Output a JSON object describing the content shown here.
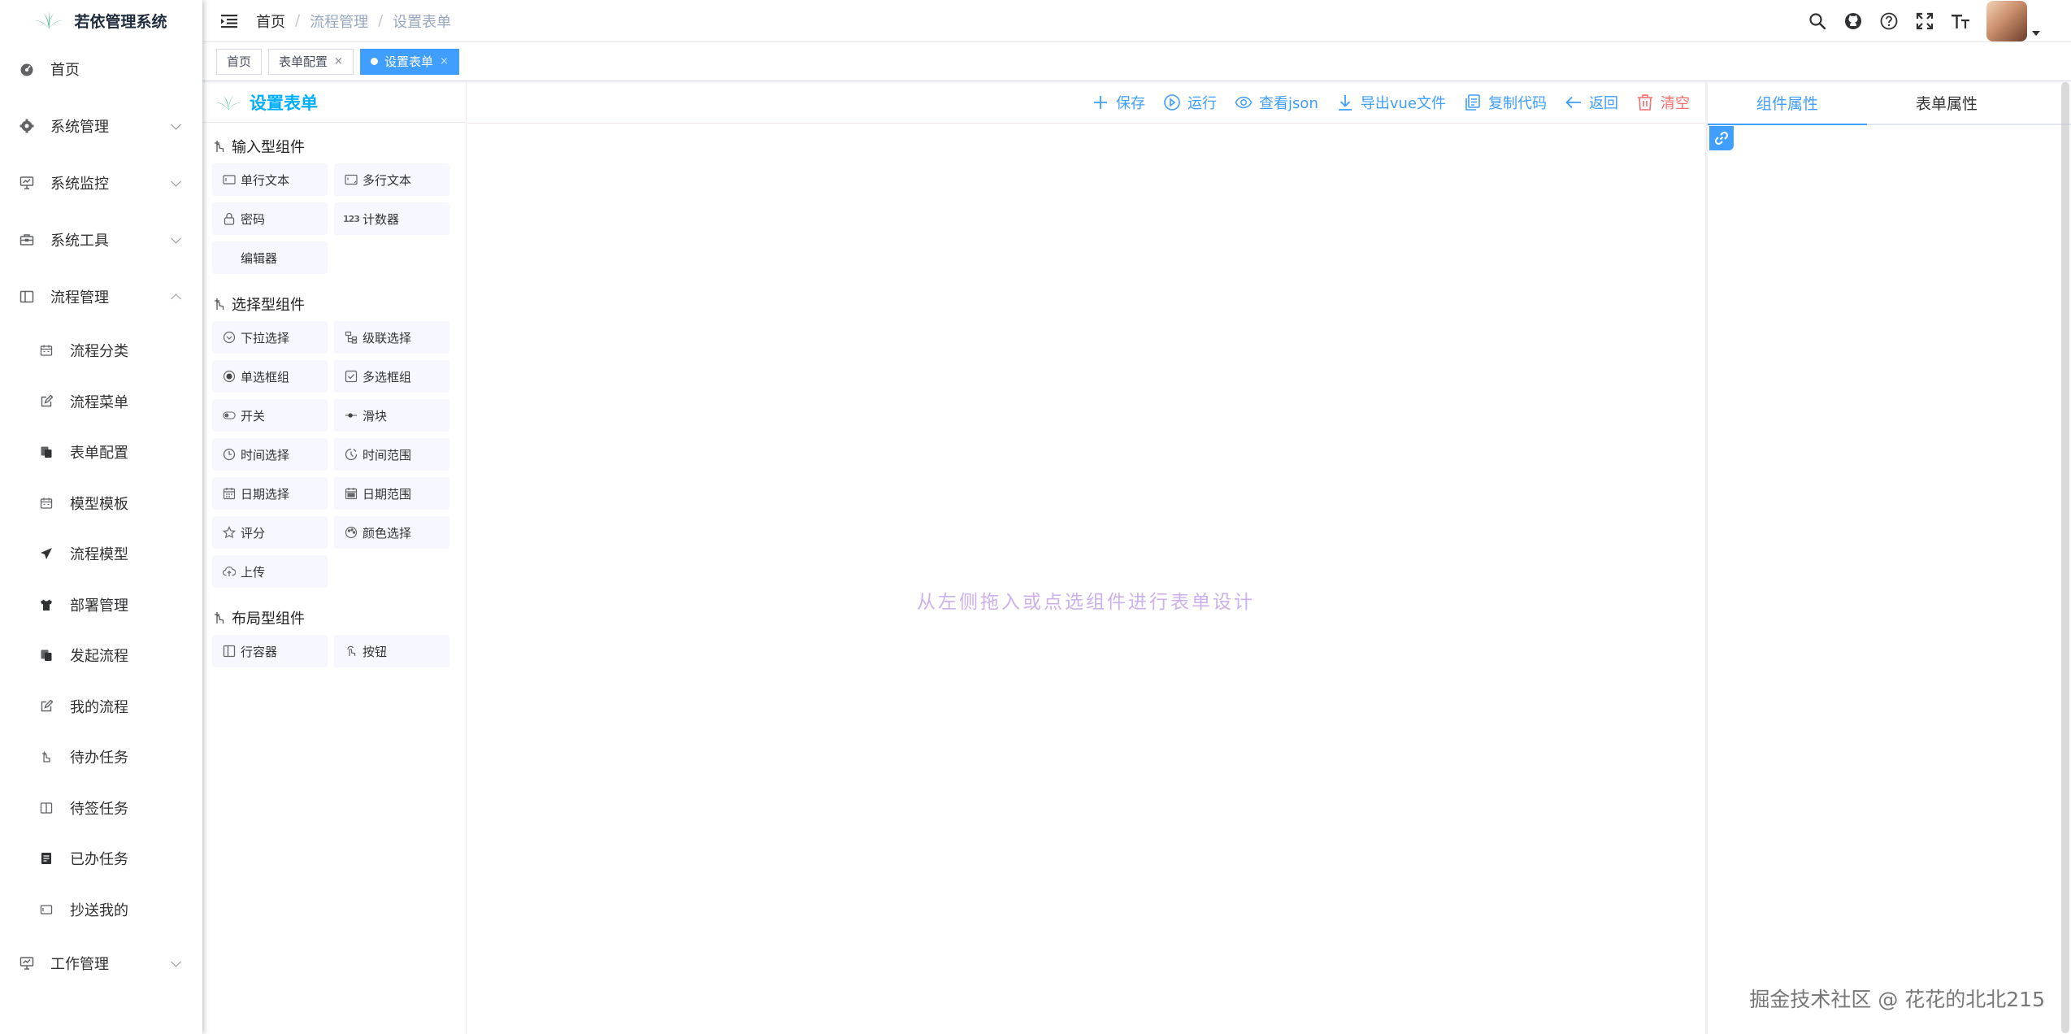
{
  "sidebar": {
    "title": "若依管理系统",
    "items": [
      {
        "label": "首页",
        "icon": "dashboard-icon",
        "expandable": false
      },
      {
        "label": "系统管理",
        "icon": "gear-icon",
        "expandable": true
      },
      {
        "label": "系统监控",
        "icon": "monitor-icon",
        "expandable": true
      },
      {
        "label": "系统工具",
        "icon": "toolbox-icon",
        "expandable": true
      },
      {
        "label": "流程管理",
        "icon": "flow-icon",
        "expandable": true,
        "expanded": true,
        "children": [
          {
            "label": "流程分类",
            "icon": "calendar-icon"
          },
          {
            "label": "流程菜单",
            "icon": "edit-icon"
          },
          {
            "label": "表单配置",
            "icon": "copy-icon"
          },
          {
            "label": "模型模板",
            "icon": "calendar-icon"
          },
          {
            "label": "流程模型",
            "icon": "send-icon"
          },
          {
            "label": "部署管理",
            "icon": "shirt-icon"
          },
          {
            "label": "发起流程",
            "icon": "copy-icon"
          },
          {
            "label": "我的流程",
            "icon": "edit-icon"
          },
          {
            "label": "待办任务",
            "icon": "drag-icon"
          },
          {
            "label": "待签任务",
            "icon": "book-icon"
          },
          {
            "label": "已办任务",
            "icon": "document-icon"
          },
          {
            "label": "抄送我的",
            "icon": "card-icon"
          }
        ]
      },
      {
        "label": "工作管理",
        "icon": "monitor-icon",
        "expandable": true
      }
    ]
  },
  "navbar": {
    "breadcrumb": [
      "首页",
      "流程管理",
      "设置表单"
    ]
  },
  "tags": [
    {
      "label": "首页",
      "active": false,
      "closable": false
    },
    {
      "label": "表单配置",
      "active": false,
      "closable": true
    },
    {
      "label": "设置表单",
      "active": true,
      "closable": true
    }
  ],
  "tag_close": "×",
  "designer": {
    "title": "设置表单",
    "groups": [
      {
        "title": "输入型组件",
        "items": [
          {
            "label": "单行文本",
            "icon": "input-icon"
          },
          {
            "label": "多行文本",
            "icon": "textarea-icon"
          },
          {
            "label": "密码",
            "icon": "lock-icon"
          },
          {
            "label": "计数器",
            "icon": "number-icon"
          },
          {
            "label": "编辑器",
            "icon": ""
          }
        ]
      },
      {
        "title": "选择型组件",
        "items": [
          {
            "label": "下拉选择",
            "icon": "select-icon"
          },
          {
            "label": "级联选择",
            "icon": "cascader-icon"
          },
          {
            "label": "单选框组",
            "icon": "radio-icon"
          },
          {
            "label": "多选框组",
            "icon": "checkbox-icon"
          },
          {
            "label": "开关",
            "icon": "switch-icon"
          },
          {
            "label": "滑块",
            "icon": "slider-icon"
          },
          {
            "label": "时间选择",
            "icon": "time-icon"
          },
          {
            "label": "时间范围",
            "icon": "time-range-icon"
          },
          {
            "label": "日期选择",
            "icon": "date-icon"
          },
          {
            "label": "日期范围",
            "icon": "date-range-icon"
          },
          {
            "label": "评分",
            "icon": "star-icon"
          },
          {
            "label": "颜色选择",
            "icon": "color-icon"
          },
          {
            "label": "上传",
            "icon": "upload-icon"
          }
        ]
      },
      {
        "title": "布局型组件",
        "items": [
          {
            "label": "行容器",
            "icon": "row-icon"
          },
          {
            "label": "按钮",
            "icon": "button-icon"
          }
        ]
      }
    ],
    "actions": [
      {
        "label": "保存",
        "icon": "plus-icon",
        "danger": false
      },
      {
        "label": "运行",
        "icon": "play-icon",
        "danger": false
      },
      {
        "label": "查看json",
        "icon": "eye-icon",
        "danger": false
      },
      {
        "label": "导出vue文件",
        "icon": "download-icon",
        "danger": false
      },
      {
        "label": "复制代码",
        "icon": "copy-doc-icon",
        "danger": false
      },
      {
        "label": "返回",
        "icon": "back-icon",
        "danger": false
      },
      {
        "label": "清空",
        "icon": "trash-icon",
        "danger": true
      }
    ],
    "empty_text": "从左侧拖入或点选组件进行表单设计",
    "right_tabs": [
      {
        "label": "组件属性",
        "active": true
      },
      {
        "label": "表单属性",
        "active": false
      }
    ]
  },
  "watermark": "掘金技术社区 @ 花花的北北215",
  "colors": {
    "primary": "#409eff",
    "danger": "#f56c6c",
    "logo": "#00afff",
    "empty": "#ccb1ea"
  }
}
